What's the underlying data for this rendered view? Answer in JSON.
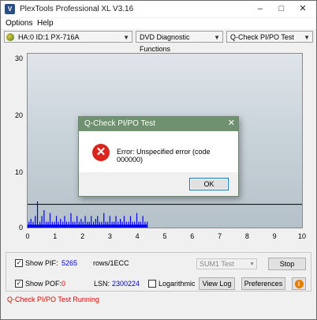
{
  "window": {
    "title": "PlexTools Professional XL V3.16",
    "app_icon_text": "V"
  },
  "menu": {
    "items": [
      "Options",
      "Help"
    ]
  },
  "toolbar": {
    "drive": "HA:0 ID:1  PX-716A",
    "function": "DVD Diagnostic Functions",
    "test": "Q-Check PI/PO Test"
  },
  "chart_data": {
    "type": "bar",
    "title": "",
    "xlabel": "",
    "ylabel": "",
    "xlim": [
      0,
      10
    ],
    "ylim": [
      0,
      30
    ],
    "x_ticks": [
      "0",
      "1",
      "2",
      "3",
      "4",
      "5",
      "6",
      "7",
      "8",
      "9",
      "10"
    ],
    "y_ticks": [
      "0",
      "10",
      "20",
      "30"
    ],
    "threshold_line": 4,
    "grid": true,
    "series": [
      {
        "color": "#0000ff",
        "x": [
          0.05,
          0.12,
          0.2,
          0.28,
          0.36,
          0.45,
          0.52,
          0.6,
          0.68,
          0.75,
          0.82,
          0.9,
          0.98,
          1.05,
          1.12,
          1.2,
          1.28,
          1.35,
          1.42,
          1.5,
          1.58,
          1.65,
          1.72,
          1.8,
          1.88,
          1.95,
          2.02,
          2.1,
          2.18,
          2.25,
          2.32,
          2.4,
          2.48,
          2.55,
          2.62,
          2.7,
          2.78,
          2.85,
          2.92,
          3.0,
          3.08,
          3.15,
          3.22,
          3.3,
          3.38,
          3.45,
          3.52,
          3.6,
          3.68,
          3.75,
          3.82,
          3.9,
          3.98,
          4.05,
          4.12,
          4.2,
          4.28,
          4.36
        ],
        "values": [
          1,
          1.5,
          1,
          2,
          4.5,
          1,
          2,
          3,
          1,
          1,
          2.5,
          1,
          1,
          2,
          1,
          1.5,
          1,
          2,
          1,
          1,
          2.5,
          1,
          1,
          2,
          1,
          1.5,
          1,
          2,
          1,
          1,
          2,
          1,
          1.5,
          2,
          1,
          1,
          2.5,
          1,
          1,
          2,
          1,
          1,
          2,
          1,
          1.5,
          1,
          2,
          1,
          1,
          2,
          1,
          1,
          2.5,
          1,
          1,
          2,
          1,
          1
        ]
      }
    ]
  },
  "dialog": {
    "title": "Q-Check PI/PO Test",
    "close_glyph": "✕",
    "icon_glyph": "✕",
    "message": "Error: Unspecified error (code 000000)",
    "ok_label": "OK"
  },
  "bottom": {
    "show_pif_label": "Show PIF:",
    "pif_value": "5265",
    "pif_value_color": "#0000cc",
    "unit_label": "rows/1ECC",
    "show_pof_label": "Show POF:",
    "pof_value": "0",
    "pof_value_color": "#e00000",
    "lsn_label": "LSN:",
    "lsn_value": "2300224",
    "logarithmic_label": "Logarithmic",
    "sum_select": "SUM1 Test",
    "stop_label": "Stop",
    "viewlog_label": "View Log",
    "preferences_label": "Preferences",
    "info_glyph": "i",
    "checkbox_checked_glyph": "✓"
  },
  "status": {
    "text": "Q-Check PI/PO Test Running"
  }
}
